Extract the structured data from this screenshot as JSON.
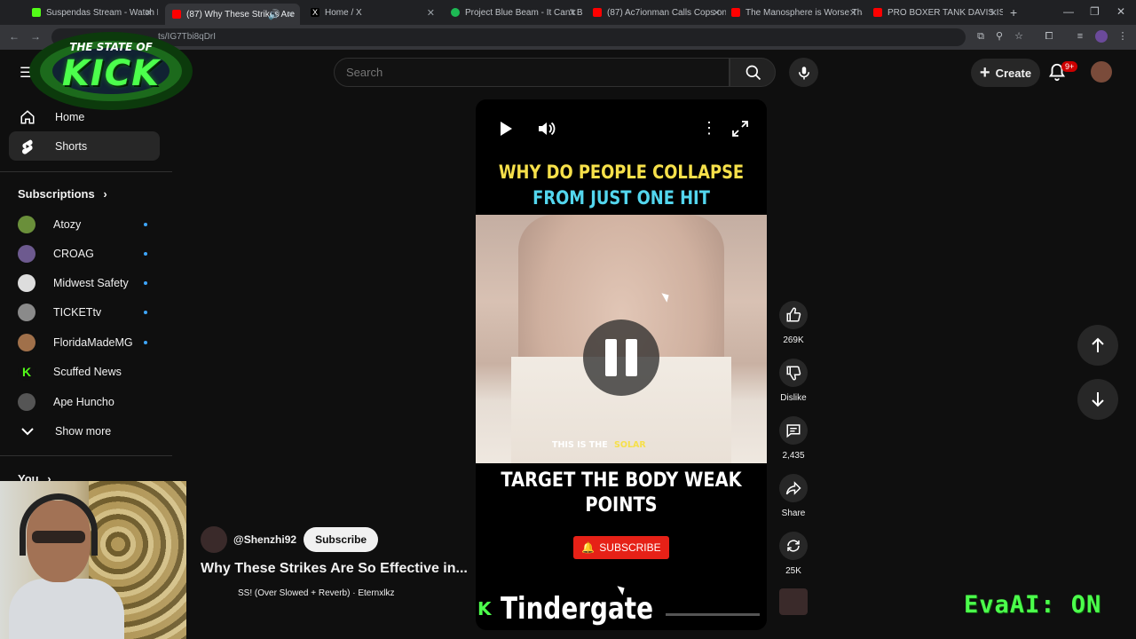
{
  "browser": {
    "tabs": [
      {
        "title": "Suspendas Stream - Watch Live",
        "color": "#53fc18"
      },
      {
        "title": "(87) Why These Strikes Are",
        "color": "#ff0000"
      },
      {
        "title": "Home / X",
        "color": "#ffffff"
      },
      {
        "title": "Project Blue Beam - It Can't Be",
        "color": "#1db954"
      },
      {
        "title": "(87) Ac7ionman Calls Cops on",
        "color": "#ff0000"
      },
      {
        "title": "The Manosphere is Worse Than",
        "color": "#ff0000"
      },
      {
        "title": "PRO BOXER TANK DAVIS IS",
        "color": "#ff0000"
      }
    ],
    "url": "ts/IG7Tbi8qDrI"
  },
  "overlay": {
    "logo_top": "THE STATE OF",
    "logo_main": "KICK",
    "tindergate_k": "K",
    "tindergate": "Tindergate",
    "evaai": "EvaAI: ON"
  },
  "header": {
    "search_placeholder": "Search",
    "create_label": "Create",
    "notif_badge": "9+"
  },
  "sidebar": {
    "home": "Home",
    "shorts": "Shorts",
    "subscriptions_heading": "Subscriptions",
    "subscriptions": [
      {
        "name": "Atozy",
        "color": "#6a8f3a"
      },
      {
        "name": "CROAG",
        "color": "#6d5a8f"
      },
      {
        "name": "Midwest Safety",
        "color": "#dddddd"
      },
      {
        "name": "TICKETtv",
        "color": "#8a8a8a"
      },
      {
        "name": "FloridaMadeMG",
        "color": "#a0704a"
      },
      {
        "name": "Scuffed News",
        "color": "#53fc18"
      },
      {
        "name": "Ape Huncho",
        "color": "#555555"
      }
    ],
    "show_more": "Show more",
    "you_heading": "You"
  },
  "video": {
    "caption_line1": "WHY DO PEOPLE COLLAPSE",
    "caption_line2": "FROM JUST ONE HIT",
    "inline_sub_a": "THIS IS THE",
    "inline_sub_b": "SOLAR",
    "caption_bottom": "TARGET THE BODY WEAK POINTS",
    "subscribe_badge": "SUBSCRIBE",
    "channel": "@Shenzhi92",
    "subscribe_btn": "Subscribe",
    "title": "Why These Strikes Are So Effective in...",
    "music": "SS! (Over Slowed + Reverb) · Eternxlkz"
  },
  "actions": {
    "likes": "269K",
    "dislike": "Dislike",
    "comments": "2,435",
    "share": "Share",
    "remix": "25K"
  }
}
